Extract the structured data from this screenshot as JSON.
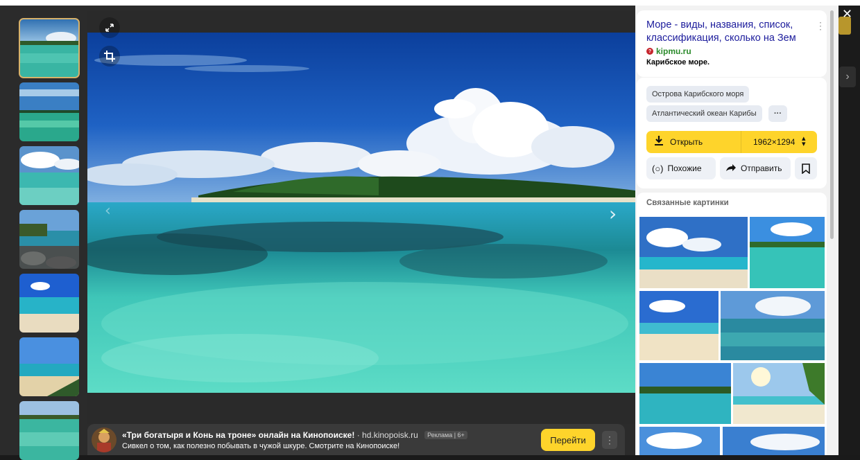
{
  "toolbar": {
    "expand_icon": "expand-icon",
    "crop_icon": "crop-icon",
    "close_icon": "close-icon"
  },
  "thumbnails": [
    {
      "name": "thumb-1",
      "active": true
    },
    {
      "name": "thumb-2",
      "active": false
    },
    {
      "name": "thumb-3",
      "active": false
    },
    {
      "name": "thumb-4",
      "active": false
    },
    {
      "name": "thumb-5",
      "active": false
    },
    {
      "name": "thumb-6",
      "active": false
    },
    {
      "name": "thumb-7",
      "active": false
    }
  ],
  "info": {
    "title": "Море - виды, названия, список, классификация, сколько на Зем",
    "source": "kipmu.ru",
    "description": "Карибское море."
  },
  "tags": [
    "Острова Карибского моря",
    "Атлантический океан Карибы",
    "···"
  ],
  "actions": {
    "open_label": "Открыть",
    "size": "1962×1294",
    "similar_label": "Похожие",
    "share_label": "Отправить"
  },
  "related": {
    "title": "Связанные картинки"
  },
  "ad": {
    "title": "«Три богатыря и Конь на троне» онлайн на Кинопоиске!",
    "domain": "· hd.kinopoisk.ru",
    "badge": "Реклама | 6+",
    "description": "Сивкел о том, как полезно побывать в чужой шкуре. Смотрите на Кинопоиске!",
    "button": "Перейти",
    "more": "⋮"
  },
  "colors": {
    "accent_yellow": "#fed42b",
    "link_blue": "#1c1c9c",
    "source_green": "#2a8a2a"
  }
}
